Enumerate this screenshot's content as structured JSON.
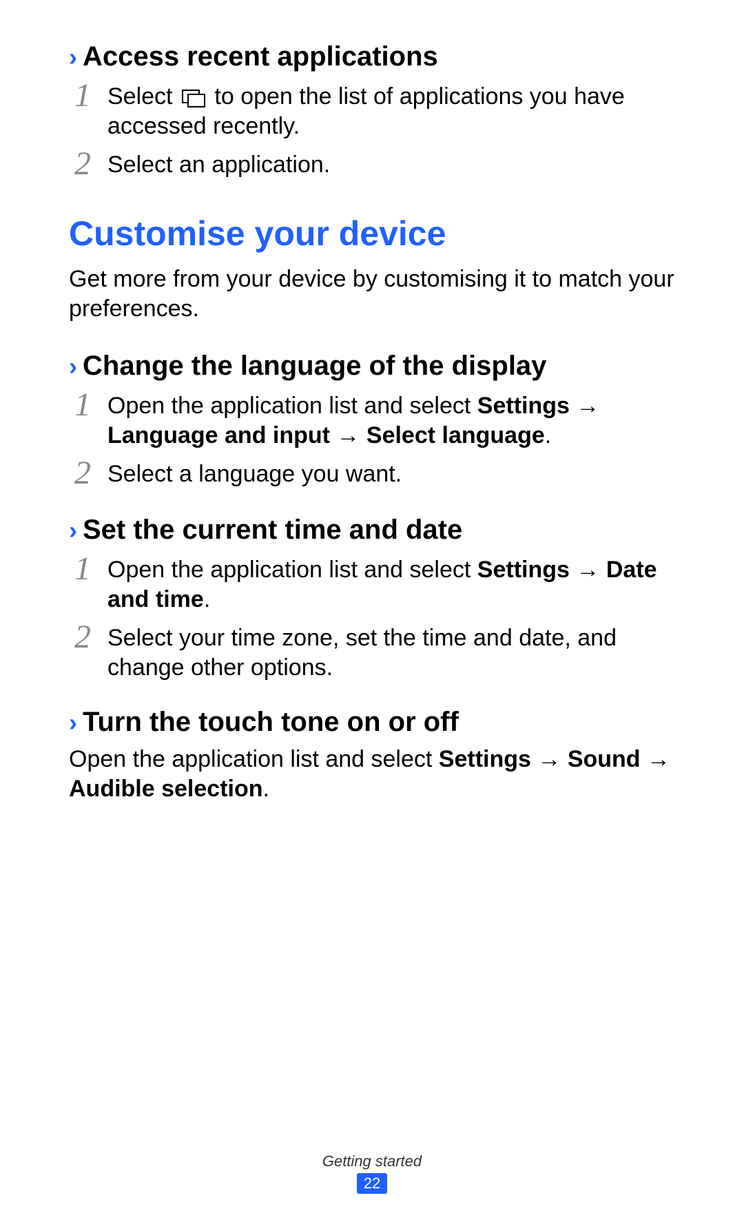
{
  "section1": {
    "title": "Access recent applications",
    "steps": [
      {
        "num": "1",
        "pre": "Select ",
        "post": " to open the list of applications you have accessed recently."
      },
      {
        "num": "2",
        "text": "Select an application."
      }
    ]
  },
  "mainHeading": "Customise your device",
  "intro": "Get more from your device by customising it to match your preferences.",
  "section2": {
    "title": "Change the language of the display",
    "steps": [
      {
        "num": "1",
        "t1": "Open the application list and select ",
        "b1": "Settings",
        "arrow1": " → ",
        "b2": "Language and input",
        "arrow2": " → ",
        "b3": "Select language",
        "tail": "."
      },
      {
        "num": "2",
        "text": "Select a language you want."
      }
    ]
  },
  "section3": {
    "title": "Set the current time and date",
    "steps": [
      {
        "num": "1",
        "t1": "Open the application list and select ",
        "b1": "Settings",
        "arrow1": " → ",
        "b2": "Date and time",
        "tail": "."
      },
      {
        "num": "2",
        "text": "Select your time zone, set the time and date, and change other options."
      }
    ]
  },
  "section4": {
    "title": "Turn the touch tone on or off",
    "para": {
      "t1": "Open the application list and select ",
      "b1": "Settings",
      "a1": " → ",
      "b2": "Sound",
      "a2": " → ",
      "b3": "Audible selection",
      "tail": "."
    }
  },
  "footer": {
    "section": "Getting started",
    "page": "22"
  }
}
